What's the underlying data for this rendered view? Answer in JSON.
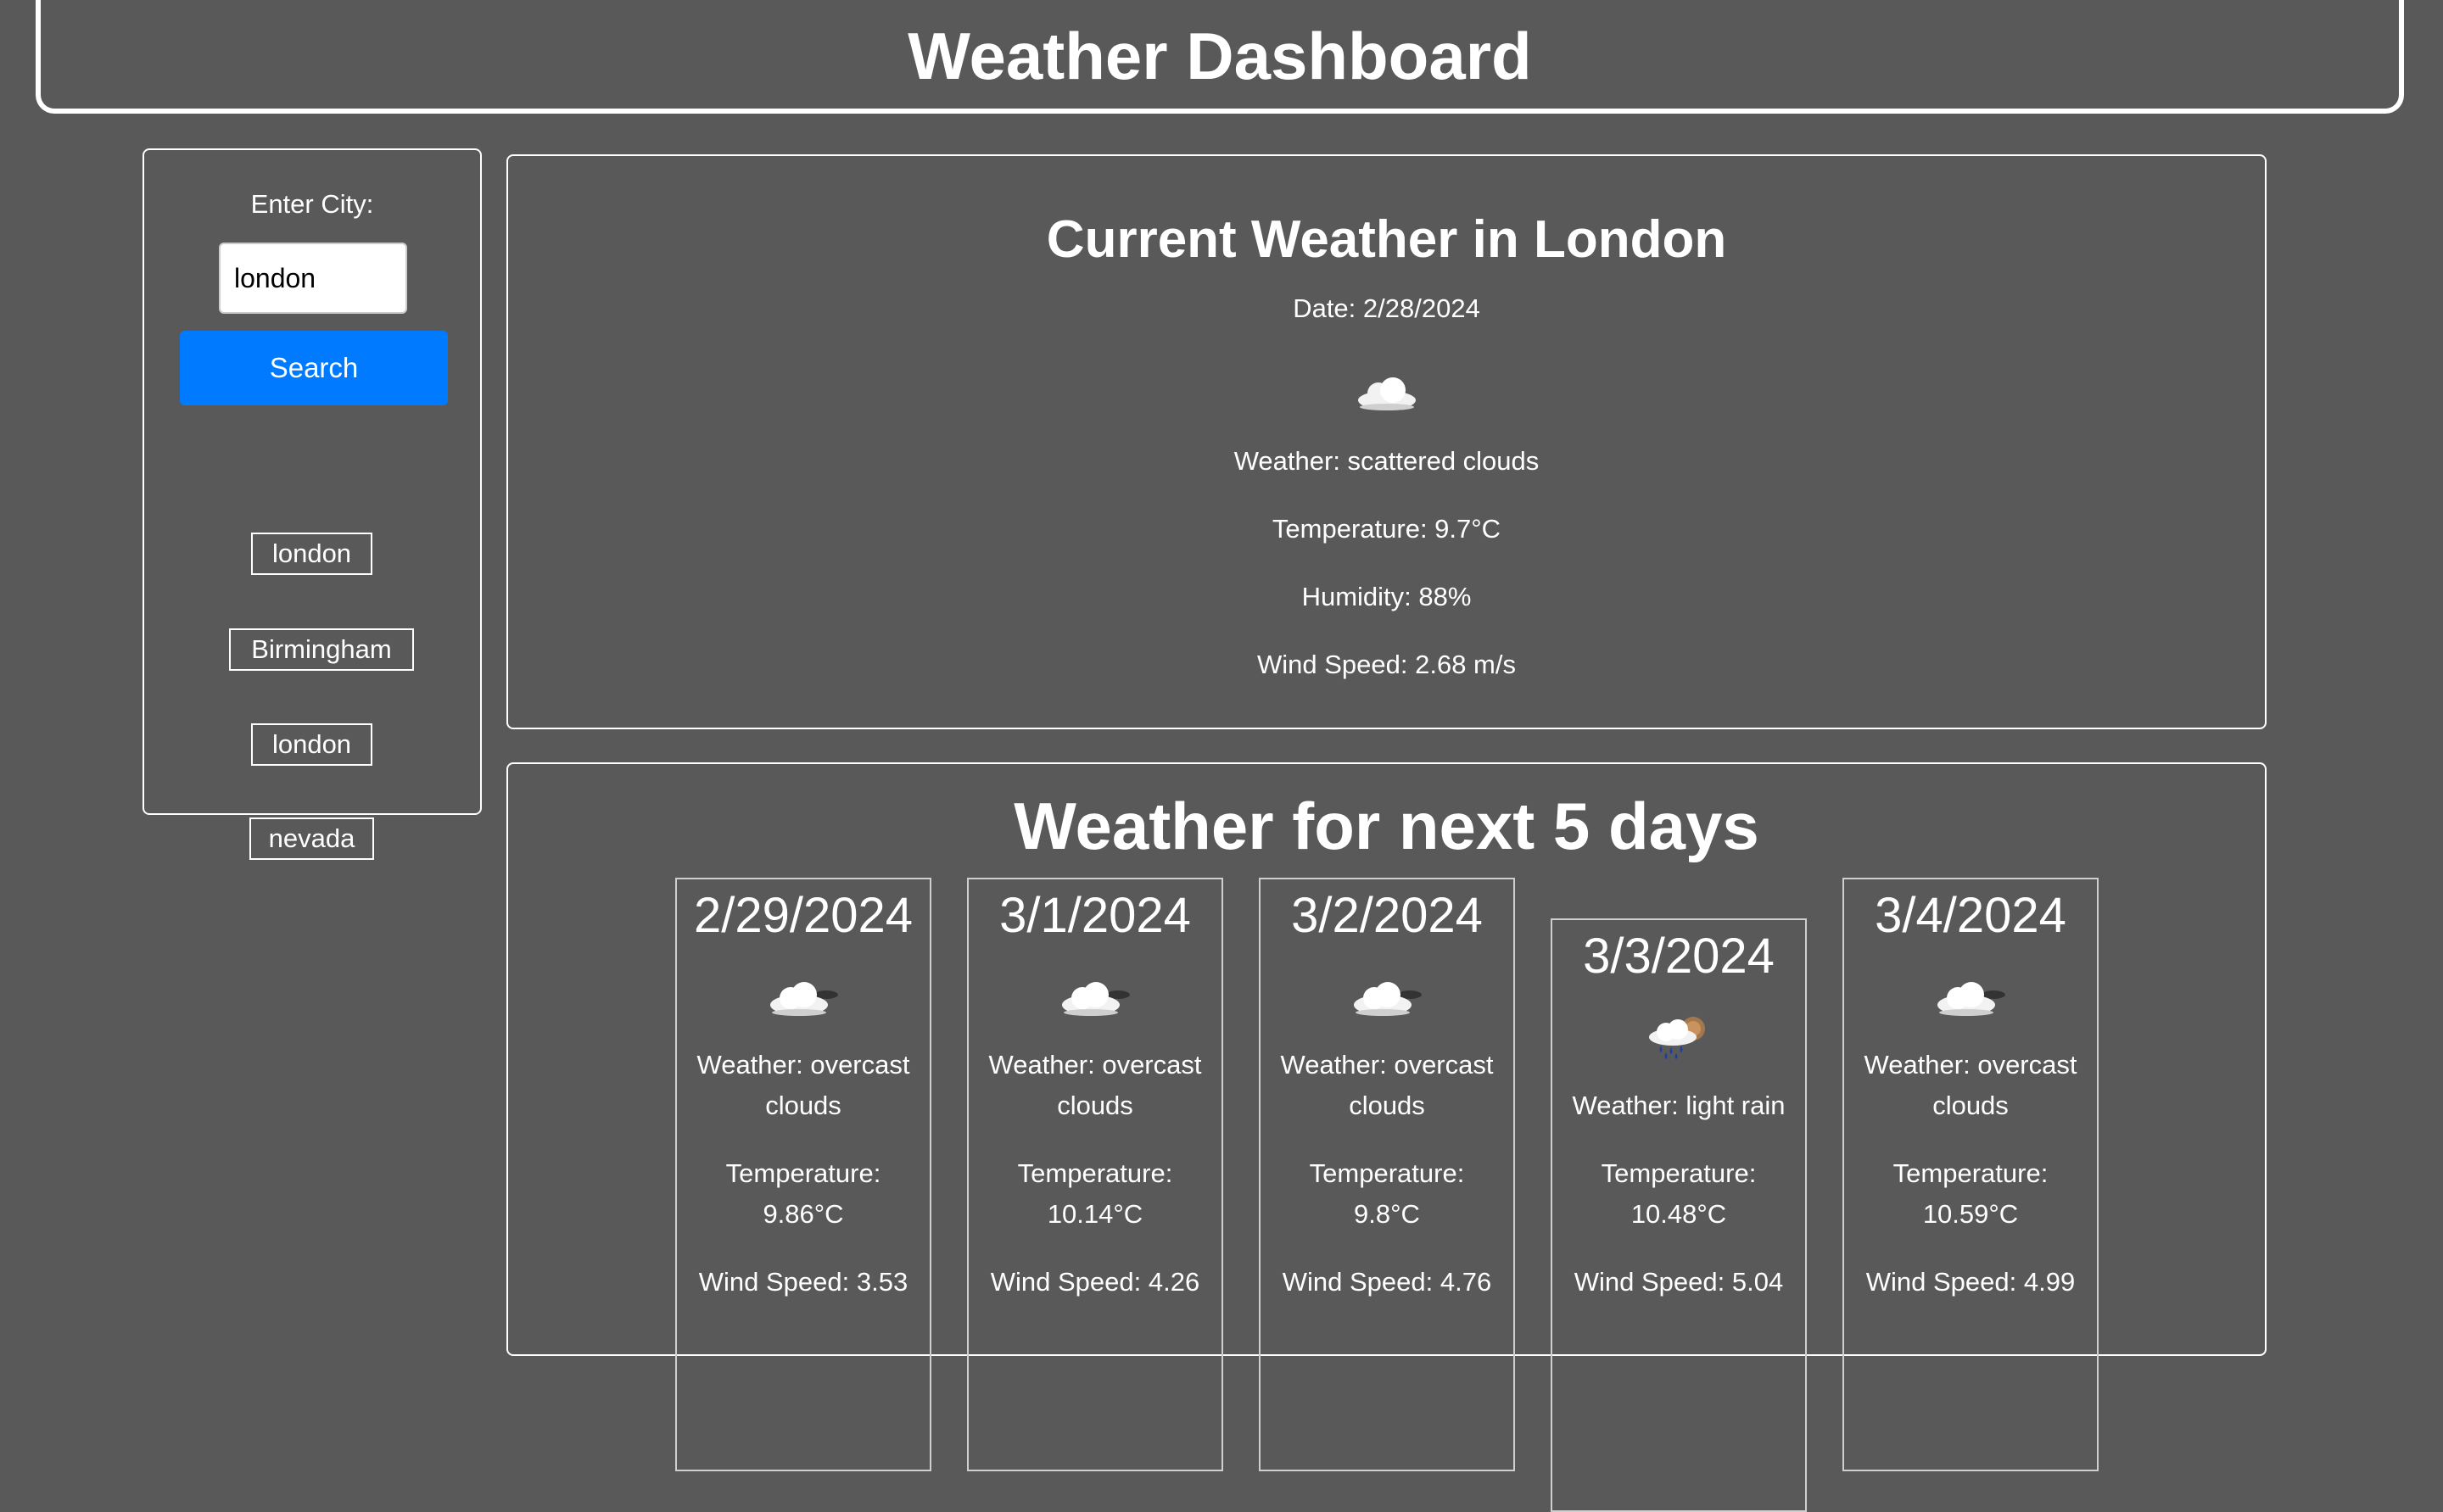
{
  "header": {
    "title": "Weather Dashboard"
  },
  "sidebar": {
    "label": "Enter City:",
    "input_value": "london",
    "search_label": "Search",
    "history": [
      "london",
      "Birmingham",
      "london",
      "nevada"
    ]
  },
  "current": {
    "title": "Current Weather in London",
    "date": "Date: 2/28/2024",
    "icon": "cloud-icon",
    "weather": "Weather: scattered clouds",
    "temperature": "Temperature: 9.7°C",
    "humidity": "Humidity: 88%",
    "wind": "Wind Speed: 2.68 m/s"
  },
  "forecast": {
    "title": "Weather for next 5 days",
    "days": [
      {
        "date": "2/29/2024",
        "icon": "overcast-clouds-icon",
        "weather_1": "Weather: overcast",
        "weather_2": "clouds",
        "temp_1": "Temperature:",
        "temp_2": "9.86°C",
        "wind": "Wind Speed: 3.53"
      },
      {
        "date": "3/1/2024",
        "icon": "overcast-clouds-icon",
        "weather_1": "Weather: overcast",
        "weather_2": "clouds",
        "temp_1": "Temperature:",
        "temp_2": "10.14°C",
        "wind": "Wind Speed: 4.26"
      },
      {
        "date": "3/2/2024",
        "icon": "overcast-clouds-icon",
        "weather_1": "Weather: overcast",
        "weather_2": "clouds",
        "temp_1": "Temperature:",
        "temp_2": "9.8°C",
        "wind": "Wind Speed: 4.76"
      },
      {
        "date": "3/3/2024",
        "icon": "light-rain-icon",
        "weather_1": "Weather: light rain",
        "weather_2": "",
        "temp_1": "Temperature:",
        "temp_2": "10.48°C",
        "wind": "Wind Speed: 5.04"
      },
      {
        "date": "3/4/2024",
        "icon": "overcast-clouds-icon",
        "weather_1": "Weather: overcast",
        "weather_2": "clouds",
        "temp_1": "Temperature:",
        "temp_2": "10.59°C",
        "wind": "Wind Speed: 4.99"
      }
    ]
  },
  "colors": {
    "background": "#595959",
    "accent": "#007bff",
    "text": "#ffffff"
  }
}
